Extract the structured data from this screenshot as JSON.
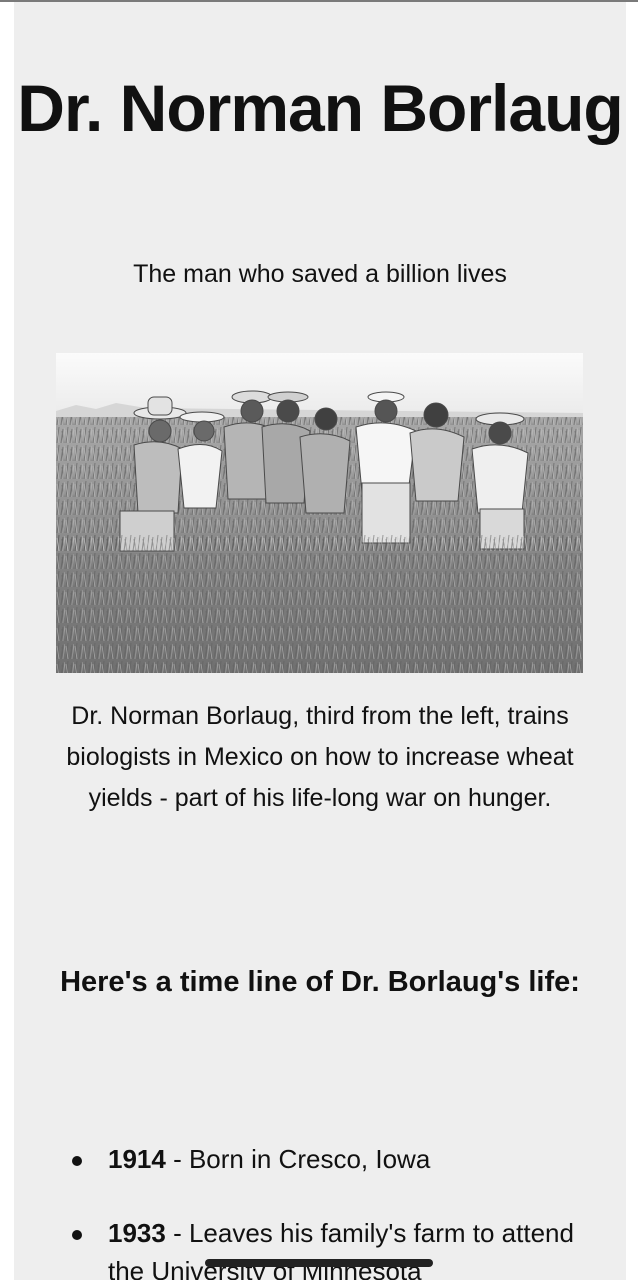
{
  "title": "Dr. Norman Borlaug",
  "subtitle": "The man who saved a billion lives",
  "photo": {
    "alt": "Dr. Norman Borlaug, third from the left, trains biologists in Mexico on how to increase wheat yields"
  },
  "caption": "Dr. Norman Borlaug, third from the left, trains biologists in Mexico on how to increase wheat yields - part of his life-long war on hunger.",
  "timeline_heading": "Here's a time line of Dr. Borlaug's life:",
  "timeline": [
    {
      "year": "1914",
      "text": " - Born in Cresco, Iowa"
    },
    {
      "year": "1933",
      "text": " - Leaves his family's farm to attend the University of Minnesota"
    }
  ]
}
